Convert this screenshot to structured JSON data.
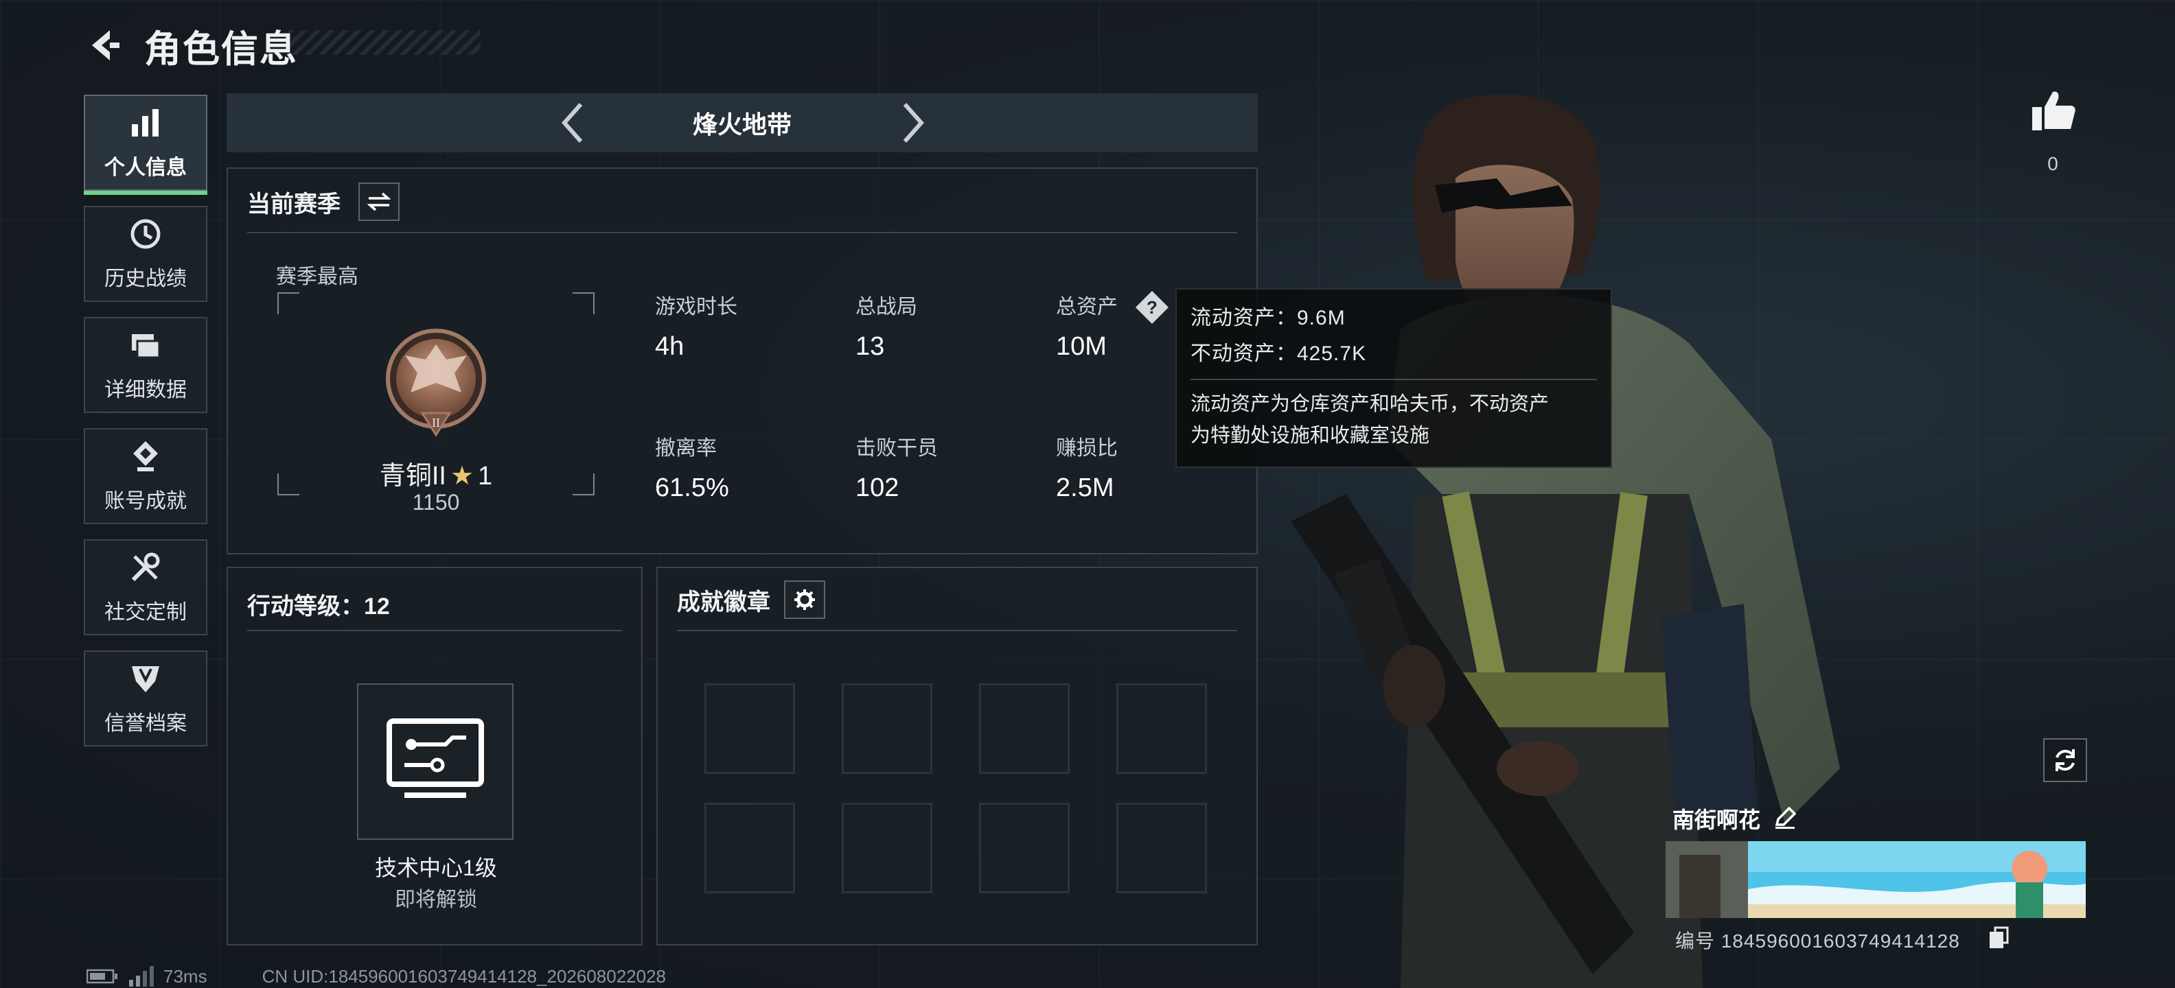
{
  "header": {
    "title": "角色信息"
  },
  "sidebar": {
    "items": [
      {
        "label": "个人信息",
        "icon": "bar-chart-icon",
        "active": true
      },
      {
        "label": "历史战绩",
        "icon": "history-clock-icon",
        "active": false
      },
      {
        "label": "详细数据",
        "icon": "folders-icon",
        "active": false
      },
      {
        "label": "账号成就",
        "icon": "achievement-icon",
        "active": false
      },
      {
        "label": "社交定制",
        "icon": "tools-icon",
        "active": false
      },
      {
        "label": "信誉档案",
        "icon": "reputation-icon",
        "active": false
      }
    ],
    "accent_color": "#6fd48b"
  },
  "mode": {
    "name": "烽火地带"
  },
  "season": {
    "title": "当前赛季",
    "best_label": "赛季最高",
    "rank_name": "青铜II",
    "rank_stars": "1",
    "rank_score": "1150",
    "stats": [
      {
        "label": "游戏时长",
        "value": "4h"
      },
      {
        "label": "总战局",
        "value": "13"
      },
      {
        "label": "总资产",
        "value": "10M"
      },
      {
        "label": "撤离率",
        "value": "61.5%"
      },
      {
        "label": "击败干员",
        "value": "102"
      },
      {
        "label": "赚损比",
        "value": "2.5M"
      }
    ]
  },
  "tooltip": {
    "liquid": "流动资产：9.6M",
    "fixed": "不动资产：425.7K",
    "desc_line1": "流动资产为仓库资产和哈夫币，不动资产",
    "desc_line2": "为特勤处设施和收藏室设施"
  },
  "level": {
    "title": "行动等级：12",
    "tech_name": "技术中心1级",
    "tech_status": "即将解锁"
  },
  "badges": {
    "title": "成就徽章",
    "slot_count": 8
  },
  "profile": {
    "likes": "0",
    "name": "南街啊花",
    "id": "编号 1845960016037494141​28"
  },
  "footer": {
    "ping": "73ms",
    "uid": "CN UID:1845960016037494141​28_202608022028"
  }
}
